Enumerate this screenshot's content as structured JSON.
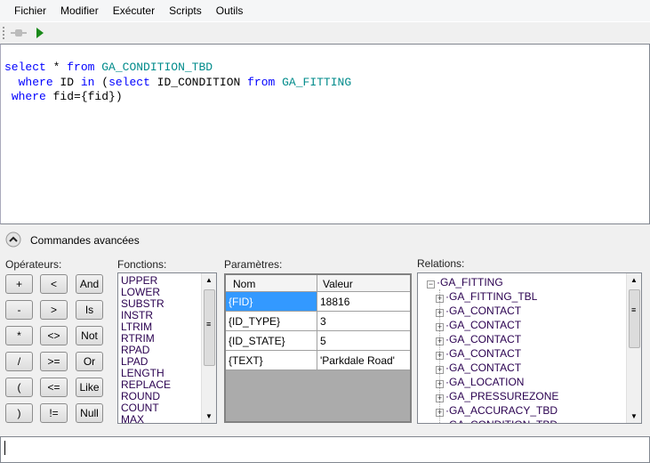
{
  "menu": [
    "Fichier",
    "Modifier",
    "Exécuter",
    "Scripts",
    "Outils"
  ],
  "toolbar": {
    "icons": [
      "plugin-icon",
      "run-icon"
    ],
    "run_color": "#1a8a1a"
  },
  "editor": {
    "lines": [
      [
        {
          "t": "select",
          "c": "kw"
        },
        {
          "t": " * ",
          "c": ""
        },
        {
          "t": "from",
          "c": "kw"
        },
        {
          "t": " ",
          "c": ""
        },
        {
          "t": "GA_CONDITION_TBD",
          "c": "tb"
        }
      ],
      [
        {
          "t": "  ",
          "c": ""
        },
        {
          "t": "where",
          "c": "kw"
        },
        {
          "t": " ID ",
          "c": ""
        },
        {
          "t": "in",
          "c": "kw"
        },
        {
          "t": " (",
          "c": ""
        },
        {
          "t": "select",
          "c": "kw"
        },
        {
          "t": " ID_CONDITION ",
          "c": ""
        },
        {
          "t": "from",
          "c": "kw"
        },
        {
          "t": " ",
          "c": ""
        },
        {
          "t": "GA_FITTING",
          "c": "tb"
        }
      ],
      [
        {
          "t": " ",
          "c": ""
        },
        {
          "t": "where",
          "c": "kw"
        },
        {
          "t": " fid={fid})",
          "c": ""
        }
      ]
    ]
  },
  "advanced": {
    "title": "Commandes avancées",
    "operators_label": "Opérateurs:",
    "operators": [
      [
        "+",
        "<",
        "And"
      ],
      [
        "-",
        ">",
        "Is"
      ],
      [
        "*",
        "<>",
        "Not"
      ],
      [
        "/",
        ">=",
        "Or"
      ],
      [
        "(",
        "<=",
        "Like"
      ],
      [
        ")",
        "!=",
        "Null"
      ]
    ],
    "functions_label": "Fonctions:",
    "functions": [
      "UPPER",
      "LOWER",
      "SUBSTR",
      "INSTR",
      "LTRIM",
      "RTRIM",
      "RPAD",
      "LPAD",
      "LENGTH",
      "REPLACE",
      "ROUND",
      "COUNT",
      "MAX"
    ],
    "params_label": "Paramètres:",
    "params_headers": [
      "Nom",
      "Valeur"
    ],
    "params": [
      [
        "{FID}",
        "18816"
      ],
      [
        "{ID_TYPE}",
        "3"
      ],
      [
        "{ID_STATE}",
        "5"
      ],
      [
        "{TEXT}",
        "'Parkdale Road'"
      ]
    ],
    "relations_label": "Relations:",
    "relations_root": "GA_FITTING",
    "relations": [
      "GA_FITTING_TBL",
      "GA_CONTACT",
      "GA_CONTACT",
      "GA_CONTACT",
      "GA_CONTACT",
      "GA_CONTACT",
      "GA_LOCATION",
      "GA_PRESSUREZONE",
      "GA_ACCURACY_TBD",
      "GA_CONDITION_TBD"
    ]
  },
  "output": {
    "value": ""
  }
}
